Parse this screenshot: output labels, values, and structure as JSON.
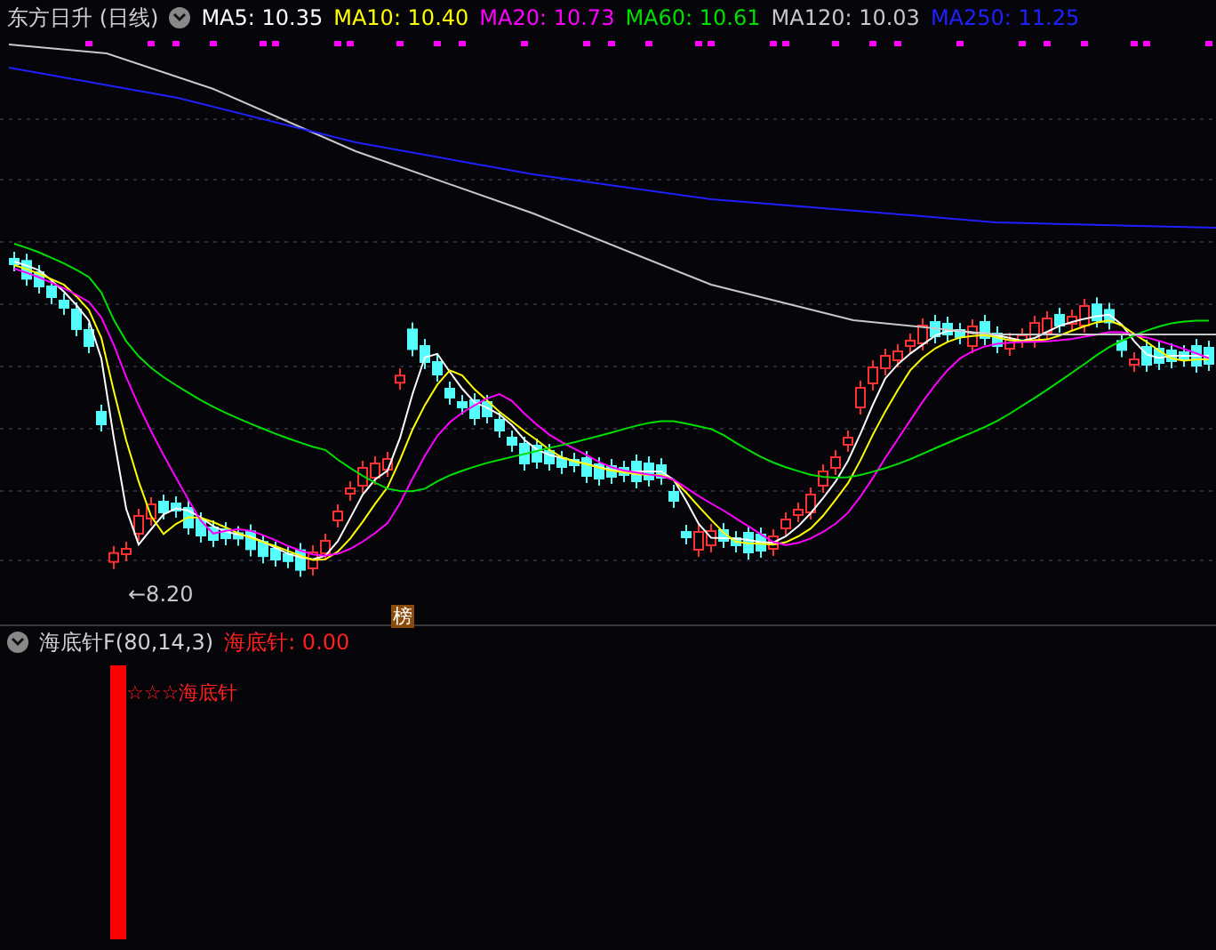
{
  "main_panel": {
    "title": "东方日升 (日线)",
    "ma_legend": [
      {
        "label": "MA5: 10.35",
        "color": "#ffffff"
      },
      {
        "label": "MA10: 10.40",
        "color": "#ffff00"
      },
      {
        "label": "MA20: 10.73",
        "color": "#ff00ff"
      },
      {
        "label": "MA60: 10.61",
        "color": "#00e000"
      },
      {
        "label": "MA120: 10.03",
        "color": "#c8c8c8"
      },
      {
        "label": "MA250: 11.25",
        "color": "#2020ff"
      }
    ],
    "low_marker": "←8.20",
    "badge": "榜"
  },
  "indicator_panel": {
    "title": "海底针F(80,14,3)",
    "reading": "海底针: 0.00",
    "signal_label": "☆☆☆海底针"
  }
}
